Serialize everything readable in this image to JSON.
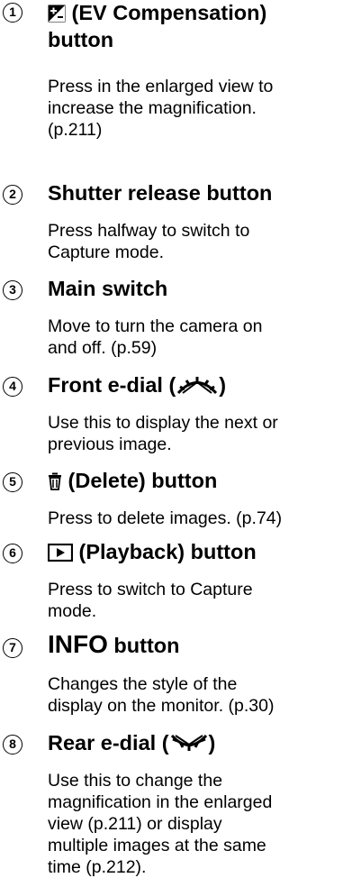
{
  "items": [
    {
      "num": "1",
      "title": "(EV Compensation)",
      "title2": "button",
      "icon": "ev-compensation-icon",
      "lines": [
        "Press in the enlarged view to",
        "increase the magnification.",
        "(p.211)"
      ]
    },
    {
      "num": "2",
      "title": "Shutter release button",
      "lines": [
        "Press halfway to switch to",
        "Capture mode."
      ]
    },
    {
      "num": "3",
      "title": "Main switch",
      "lines": [
        "Move to turn the camera on",
        "and off. (p.59)"
      ]
    },
    {
      "num": "4",
      "title_pre": "Front e-dial (",
      "title_post": ")",
      "icon": "front-dial-icon",
      "lines": [
        "Use this to display the next or",
        "previous image."
      ]
    },
    {
      "num": "5",
      "title": "(Delete) button",
      "icon": "trash-icon",
      "lines": [
        "Press to delete images. (p.74)"
      ]
    },
    {
      "num": "6",
      "title": "(Playback) button",
      "icon": "playback-icon",
      "lines": [
        "Press to switch to Capture",
        "mode."
      ]
    },
    {
      "num": "7",
      "title_big": "INFO",
      "title_small": "button",
      "lines": [
        "Changes the style of the",
        "display on the monitor. (p.30)"
      ]
    },
    {
      "num": "8",
      "title_pre": "Rear e-dial (",
      "title_post": ")",
      "icon": "rear-dial-icon",
      "lines": [
        "Use this to change the",
        "magnification in the enlarged",
        "view (p.211) or display",
        "multiple images at the same",
        "time (p.212)."
      ]
    }
  ]
}
